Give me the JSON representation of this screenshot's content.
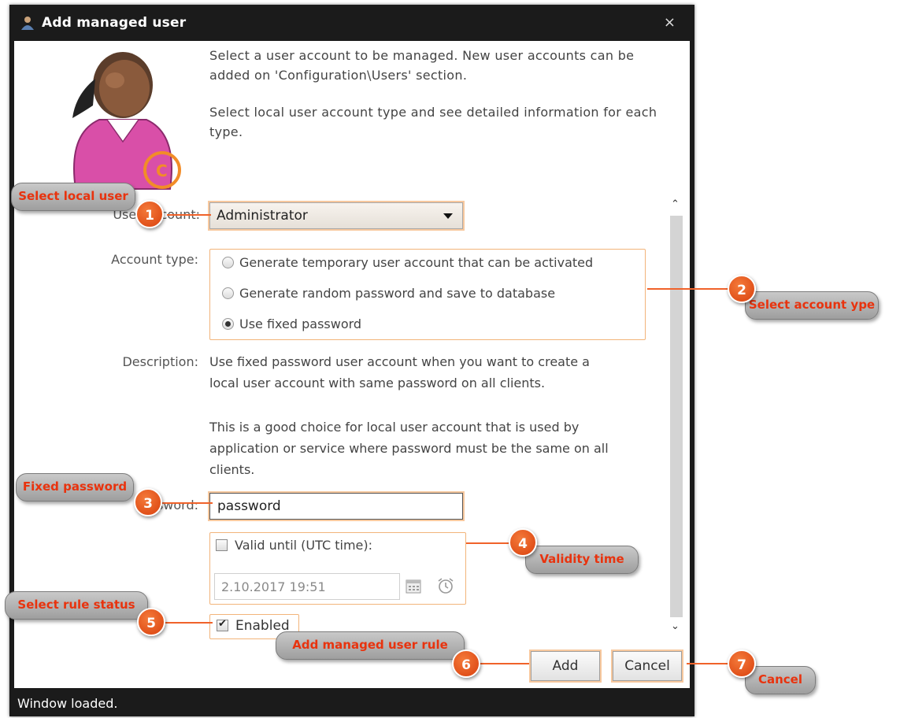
{
  "window": {
    "title": "Add managed user",
    "close_glyph": "×",
    "status": "Window loaded."
  },
  "intro": {
    "para1": "Select a user account to be managed. New user accounts can be added on 'Configuration\\Users' section.",
    "para2": "Select local user account type and see detailed information for each type."
  },
  "form": {
    "user_account_label": "User account:",
    "user_account_value": "Administrator",
    "account_type_label": "Account type:",
    "account_types": [
      {
        "label": "Generate temporary user account that can be activated",
        "selected": false
      },
      {
        "label": "Generate random password and save to database",
        "selected": false
      },
      {
        "label": "Use fixed password",
        "selected": true
      }
    ],
    "description_label": "Description:",
    "description_1": "Use fixed password user account when you want to create a local user account with same password on all clients.",
    "description_2": "This is a good choice for local user account that is used by application or service where password must be the same on all clients.",
    "password_label": "Password:",
    "password_value": "password",
    "valid_until_label": "Valid until (UTC time):",
    "valid_until_checked": false,
    "valid_until_value": "2.10.2017 19:51",
    "enabled_label": "Enabled",
    "enabled_checked": true
  },
  "buttons": {
    "add": "Add",
    "cancel": "Cancel"
  },
  "annotations": {
    "c1": {
      "num": "1",
      "text": "Select local user"
    },
    "c2": {
      "num": "2",
      "text": "Select account ype"
    },
    "c3": {
      "num": "3",
      "text": "Fixed password"
    },
    "c4": {
      "num": "4",
      "text": "Validity time"
    },
    "c5": {
      "num": "5",
      "text": "Select rule status"
    },
    "c6": {
      "num": "6",
      "text": "Add managed user rule"
    },
    "c7": {
      "num": "7",
      "text": "Cancel"
    }
  },
  "icons": [
    "user-icon",
    "avatar-icon",
    "close-icon",
    "chevron-down-icon",
    "calendar-icon",
    "alarm-clock-icon",
    "scroll-up-icon",
    "scroll-down-icon"
  ],
  "colors": {
    "accent": "#f0622a",
    "highlight": "#f7c89e",
    "callout_text": "#e8330e",
    "title_bar": "#1b1b1b"
  }
}
